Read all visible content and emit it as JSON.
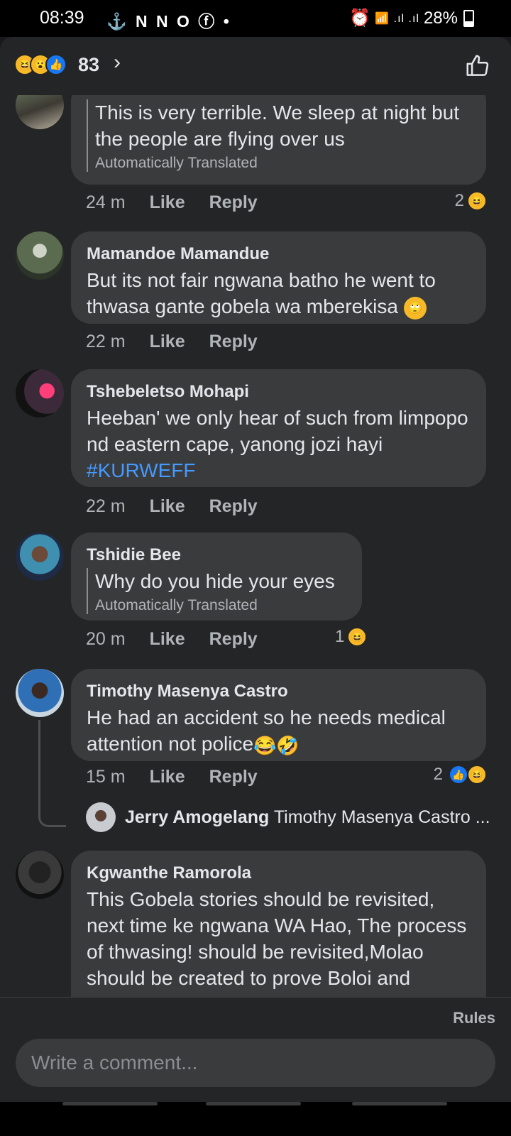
{
  "status_bar": {
    "time": "08:39",
    "icons": "⚓ N N O ⓕ •",
    "alarm": "⏰",
    "signal": "📶 .ıl .ıl",
    "battery": "28%"
  },
  "reactions_header": {
    "count": "83",
    "icons": [
      "😆",
      "😮",
      "👍"
    ]
  },
  "comments": [
    {
      "author": "",
      "text": "This is very terrible. We sleep at night but the people are flying over us",
      "translated_label": "Automatically Translated",
      "time": "24 m",
      "like": "Like",
      "reply": "Reply",
      "reaction_count": "2",
      "reaction_icons": [
        "😆"
      ]
    },
    {
      "author": "Mamandoe Mamandue",
      "text": "But its not fair ngwana batho he went to thwasa gante  gobela wa mberekisa",
      "inline_emoji": "🙄",
      "time": "22 m",
      "like": "Like",
      "reply": "Reply"
    },
    {
      "author": "Tshebeletso Mohapi",
      "text": "Heeban' we only hear of such from limpopo nd eastern cape, yanong jozi hayi ",
      "hashtag": "#KURWEFF",
      "time": "22 m",
      "like": "Like",
      "reply": "Reply"
    },
    {
      "author": "Tshidie Bee",
      "text": "Why do you hide your eyes",
      "translated_label": "Automatically Translated",
      "time": "20 m",
      "like": "Like",
      "reply": "Reply",
      "reaction_count": "1",
      "reaction_icons": [
        "😆"
      ]
    },
    {
      "author": "Timothy Masenya Castro",
      "text": "He had an accident so he needs medical attention not police",
      "inline_emoji": "😂🤣",
      "time": "15 m",
      "like": "Like",
      "reply": "Reply",
      "reaction_count": "2",
      "reaction_icons": [
        "👍",
        "😆"
      ],
      "reply_preview": {
        "author": "Jerry Amogelang",
        "text": "Timothy Masenya Castro ..."
      }
    },
    {
      "author": "Kgwanthe Ramorola",
      "text": "This Gobela stories should be revisited, next time ke ngwana WA Hao, The process of thwasing! should be revisited,Molao should be created to prove Boloi and perpetrators should be"
    }
  ],
  "footer": {
    "rules": "Rules",
    "placeholder": "Write a comment..."
  }
}
